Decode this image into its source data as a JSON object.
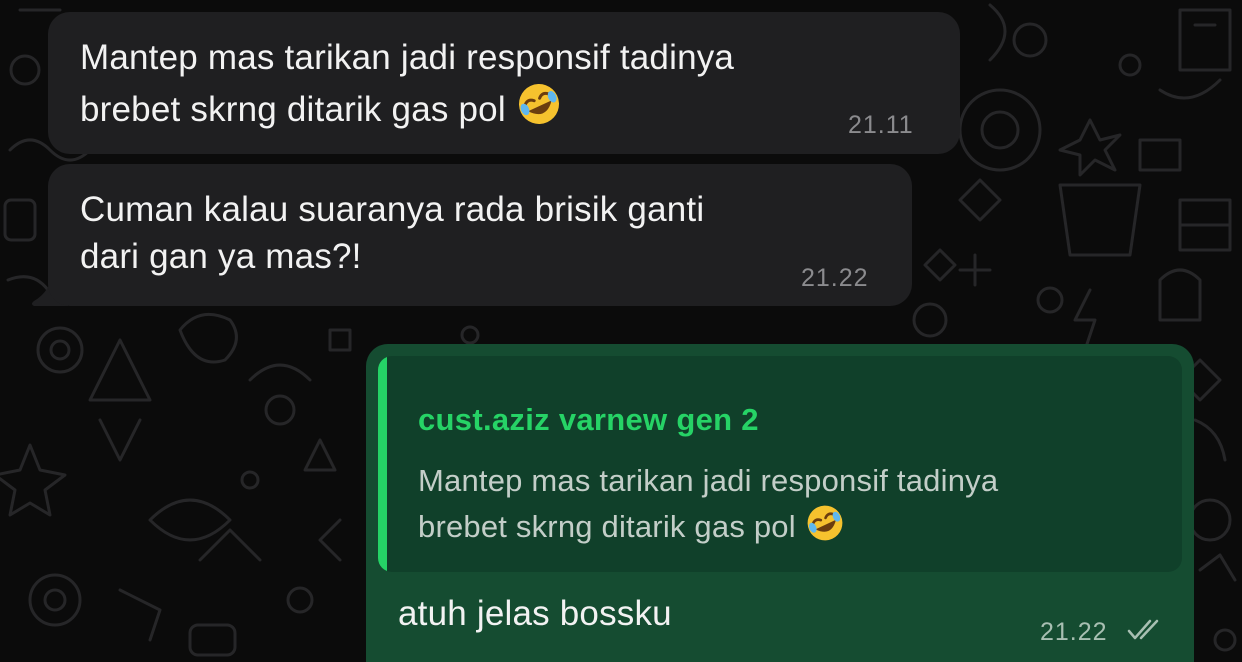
{
  "colors": {
    "background": "#0b0b0b",
    "incoming_bubble": "#1f1f21",
    "outgoing_bubble": "#154c31",
    "quote_background": "#10402a",
    "quote_accent": "#25d366",
    "timestamp": "#8b8b8e"
  },
  "messages": [
    {
      "direction": "incoming",
      "line1": "Mantep mas tarikan jadi responsif tadinya",
      "line2": "brebet skrng ditarik gas pol",
      "emoji": "rolling-on-floor-laughing",
      "time": "21.11"
    },
    {
      "direction": "incoming",
      "line1": "Cuman kalau suaranya rada brisik ganti",
      "line2": "dari gan ya mas?!",
      "time": "21.22"
    },
    {
      "direction": "outgoing",
      "quote": {
        "author": "cust.aziz varnew gen 2",
        "line1": "Mantep mas tarikan jadi responsif tadinya",
        "line2": "brebet skrng ditarik gas pol",
        "emoji": "rolling-on-floor-laughing"
      },
      "text": "atuh jelas bossku",
      "time": "21.22",
      "status": "read-double-check"
    }
  ]
}
